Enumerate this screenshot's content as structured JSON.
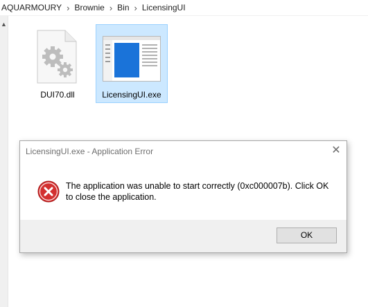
{
  "breadcrumb": {
    "items": [
      "AQUARMOURY",
      "Brownie",
      "Bin",
      "LicensingUI"
    ],
    "separator": "›"
  },
  "files": [
    {
      "name": "DUI70.dll",
      "icon": "dll-settings-icon",
      "selected": false
    },
    {
      "name": "LicensingUI.exe",
      "icon": "application-window-icon",
      "selected": true
    }
  ],
  "dialog": {
    "title": "LicensingUI.exe - Application Error",
    "message": "The application was unable to start correctly (0xc000007b). Click OK to close the application.",
    "icon": "error-icon",
    "ok_label": "OK",
    "close_glyph": "✕"
  },
  "colors": {
    "selection_fill": "#cce8ff",
    "selection_border": "#99d1ff",
    "error_red": "#d32f2f",
    "app_blue": "#1a73d9"
  }
}
